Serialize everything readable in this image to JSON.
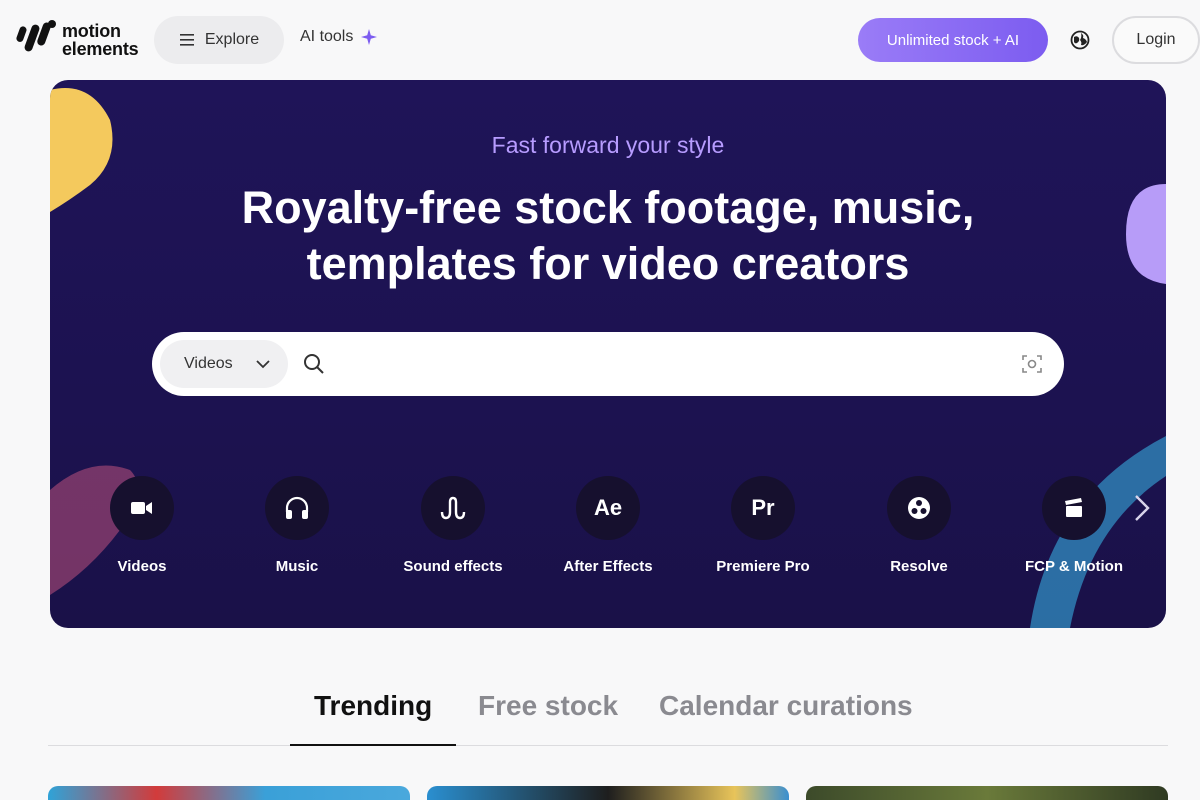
{
  "header": {
    "logo_line1": "motion",
    "logo_line2": "elements",
    "explore_label": "Explore",
    "ai_tools_label": "AI tools",
    "unlimited_label": "Unlimited stock + AI",
    "login_label": "Login"
  },
  "hero": {
    "tagline": "Fast forward your style",
    "headline_line1": "Royalty-free stock footage, music,",
    "headline_line2": "templates for video creators",
    "search": {
      "type_selected": "Videos",
      "placeholder": ""
    },
    "categories": [
      {
        "label": "Videos",
        "icon": "video-camera-icon"
      },
      {
        "label": "Music",
        "icon": "headphones-icon"
      },
      {
        "label": "Sound effects",
        "icon": "sound-wave-icon"
      },
      {
        "label": "After Effects",
        "icon": "after-effects-icon",
        "glyph": "Ae"
      },
      {
        "label": "Premiere Pro",
        "icon": "premiere-pro-icon",
        "glyph": "Pr"
      },
      {
        "label": "Resolve",
        "icon": "resolve-icon"
      },
      {
        "label": "FCP & Motion",
        "icon": "clapperboard-icon"
      }
    ]
  },
  "tabs": [
    {
      "label": "Trending",
      "active": true
    },
    {
      "label": "Free stock",
      "active": false
    },
    {
      "label": "Calendar curations",
      "active": false
    }
  ],
  "colors": {
    "accent": "#7c5cf0",
    "hero_bg": "#1e1456",
    "tagline": "#b79cff"
  }
}
